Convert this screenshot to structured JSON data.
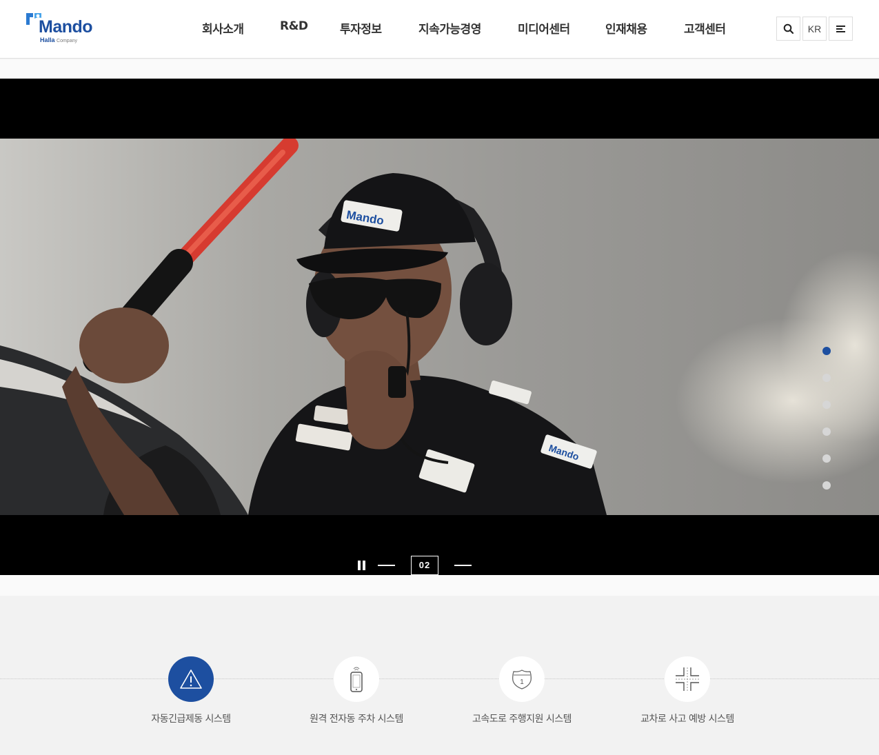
{
  "header": {
    "logo": {
      "word": "Mando",
      "sub_brand": "Halla",
      "sub_suffix": "Company"
    },
    "nav": [
      "회사소개",
      "R&D",
      "투자정보",
      "지속가능경영",
      "미디어센터",
      "인재채용",
      "고객센터"
    ],
    "util": {
      "search_icon": "search-icon",
      "lang": "KR",
      "menu_icon": "menu-icon"
    }
  },
  "hero": {
    "slide_number": "02",
    "pager_count": 6,
    "active_slide_index": 0,
    "scene": {
      "cap_text": "Mando",
      "shirt_badge": "Mando"
    }
  },
  "features": {
    "items": [
      {
        "label": "자동긴급제동 시스템",
        "icon": "warning-icon",
        "active": true
      },
      {
        "label": "원격 전자동 주차 시스템",
        "icon": "smartphone-icon",
        "active": false
      },
      {
        "label": "고속도로 주행지원 시스템",
        "icon": "highway-shield-icon",
        "active": false
      },
      {
        "label": "교차로 사고 예방 시스템",
        "icon": "intersection-icon",
        "active": false
      }
    ]
  },
  "colors": {
    "brand": "#1d4fa0",
    "text": "#333333",
    "hero_bg": "#000000"
  }
}
